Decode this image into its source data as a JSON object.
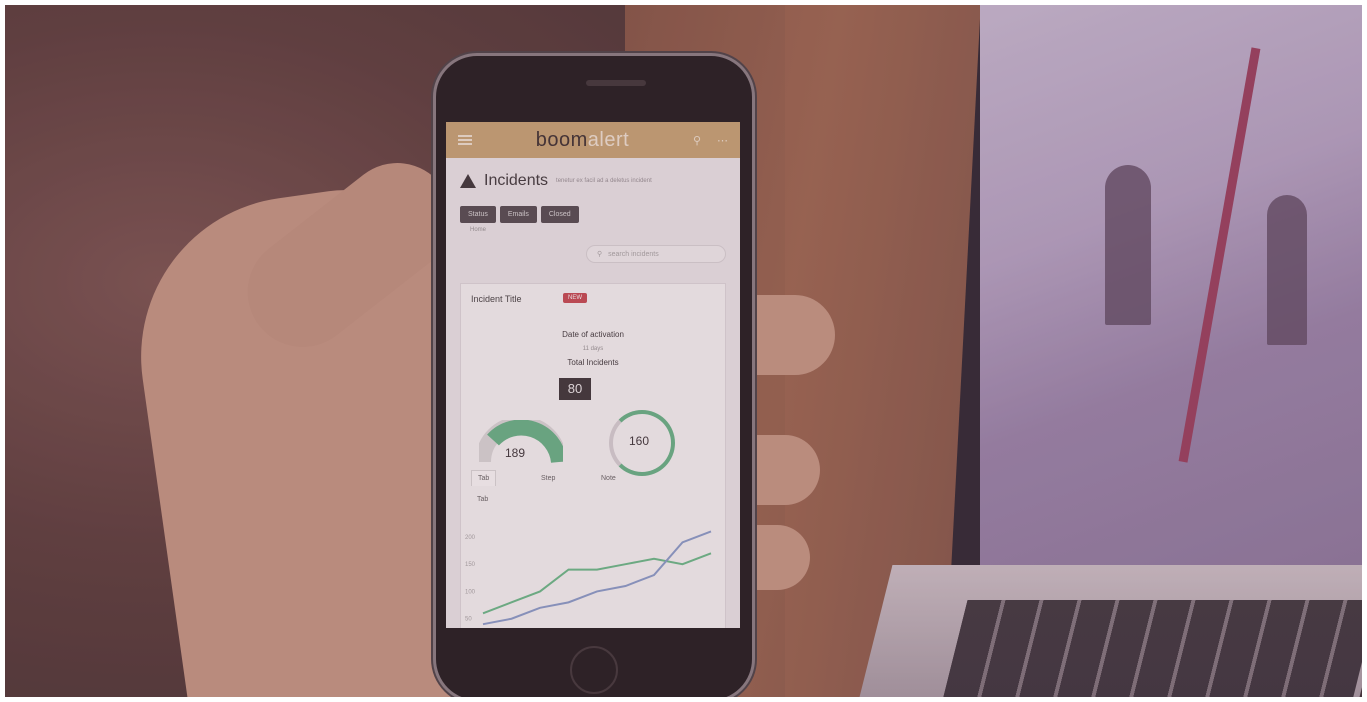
{
  "app": {
    "logo_part1": "boom",
    "logo_part2": "alert",
    "title": "Incidents",
    "subtitle": "tenetur ex facil ad a deletus incident",
    "buttons": [
      "Status",
      "Emails",
      "Closed"
    ],
    "breadcrumb": "Home",
    "search_placeholder": "search incidents"
  },
  "card": {
    "title": "Incident Title",
    "badge": "NEW",
    "line1": "Date of activation",
    "line2": "11 days",
    "line3": "Total Incidents",
    "total": "80",
    "gauge_left_value": "189",
    "gauge_right_value": "160",
    "tabs": [
      "Tab",
      "Step",
      "Note",
      "Tab"
    ]
  },
  "chart_data": {
    "type": "line",
    "x": [
      1,
      2,
      3,
      4,
      5,
      6,
      7,
      8,
      9
    ],
    "series": [
      {
        "values": [
          60,
          80,
          100,
          140,
          140,
          150,
          160,
          150,
          170
        ]
      },
      {
        "values": [
          40,
          50,
          70,
          80,
          100,
          110,
          130,
          190,
          210
        ]
      }
    ],
    "y_tick_labels": [
      "200",
      "150",
      "100",
      "50"
    ],
    "colors": [
      "#6abf8b",
      "#8aa0cf"
    ]
  },
  "colors": {
    "appbar": "#caa877",
    "accent_green": "#66b889",
    "badge_red": "#c94a52"
  }
}
